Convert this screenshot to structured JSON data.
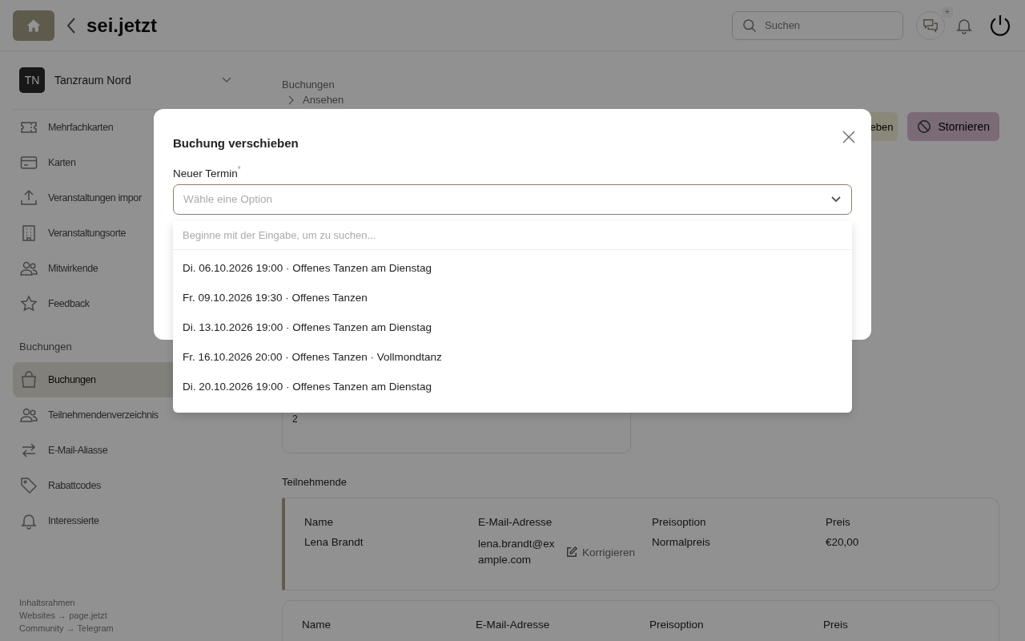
{
  "header": {
    "logo": "sei.jetzt",
    "search": {
      "placeholder": "Suchen"
    },
    "chat_badge": "+"
  },
  "organization": {
    "initials": "TN",
    "name": "Tanzraum Nord"
  },
  "sidebar": {
    "items": [
      {
        "label": "Mehrfachkarten",
        "selected": false
      },
      {
        "label": "Karten",
        "selected": false
      },
      {
        "label": "Veranstaltungen impor",
        "selected": false
      },
      {
        "label": "Veranstaltungsorte",
        "selected": false
      },
      {
        "label": "Mitwirkende",
        "selected": false
      },
      {
        "label": "Feedback",
        "selected": false
      }
    ],
    "section": "Buchungen",
    "section_items": [
      {
        "label": "Buchungen",
        "selected": true
      },
      {
        "label": "Teilnehmendenverzeichnis",
        "selected": false
      },
      {
        "label": "E-Mail-Aliasse",
        "selected": false
      },
      {
        "label": "Rabattcodes",
        "selected": false
      },
      {
        "label": "Interessierte",
        "selected": false
      }
    ],
    "footer_links": [
      "Inhaltsrahmen",
      "Websites → page.jetzt",
      "Community → Telegram"
    ]
  },
  "breadcrumb": [
    "Buchungen",
    "Ansehen"
  ],
  "actions": [
    {
      "kind": "edit",
      "label": "eben"
    },
    {
      "kind": "cancel",
      "label": "Stornieren"
    }
  ],
  "card_fragment": "2",
  "participants": {
    "heading": "Teilnehmende",
    "cards": [
      {
        "columns": [
          "Name",
          "E-Mail-Adresse",
          "Preisoption",
          "Preis"
        ],
        "name": "Lena Brandt",
        "email": "lena.brandt@example.com",
        "action": "Korrigieren",
        "price_option": "Normalpreis",
        "price": "€20,00",
        "selected": true
      },
      {
        "columns": [
          "Name",
          "E-Mail-Adresse",
          "Preisoption",
          "Preis"
        ],
        "selected": false
      }
    ]
  },
  "modal": {
    "title": "Buchung verschieben",
    "field": {
      "label": "Neuer Termin",
      "required_mark": "*",
      "placeholder": "Wähle eine Option",
      "expanded": true,
      "search_placeholder": "Beginne mit der Eingabe, um zu suchen...",
      "options": [
        "Di. 06.10.2026 19:00 · Offenes Tanzen am Dienstag",
        "Fr. 09.10.2026 19:30 · Offenes Tanzen",
        "Di. 13.10.2026 19:00 · Offenes Tanzen am Dienstag",
        "Fr. 16.10.2026 20:00 · Offenes Tanzen · Vollmondtanz",
        "Di. 20.10.2026 19:00 · Offenes Tanzen am Dienstag"
      ]
    }
  }
}
